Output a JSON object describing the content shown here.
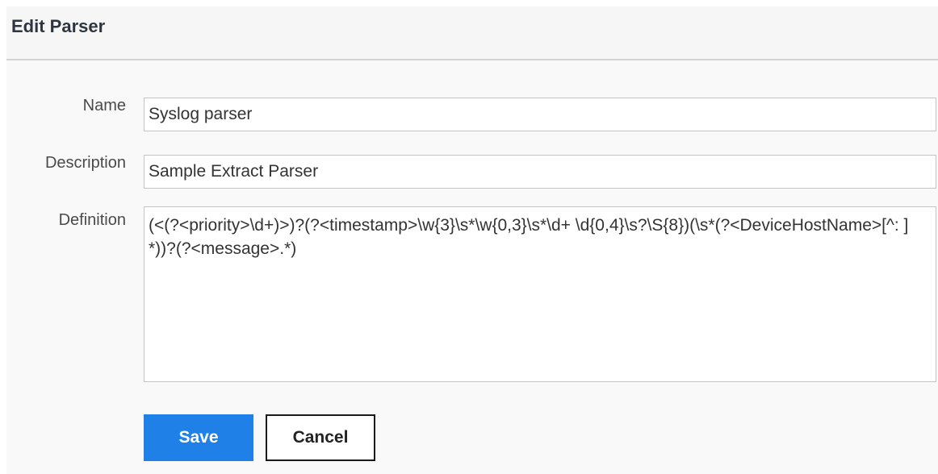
{
  "dialog": {
    "title": "Edit Parser"
  },
  "form": {
    "name": {
      "label": "Name",
      "value": "Syslog parser"
    },
    "description": {
      "label": "Description",
      "value": "Sample Extract Parser"
    },
    "definition": {
      "label": "Definition",
      "value": "(<(?<priority>\\d+)>)?(?<timestamp>\\w{3}\\s*\\w{0,3}\\s*\\d+ \\d{0,4}\\s?\\S{8})(\\s*(?<DeviceHostName>[^: ]*))?(?<message>.*)"
    }
  },
  "actions": {
    "save_label": "Save",
    "cancel_label": "Cancel"
  },
  "colors": {
    "primary_button": "#1f80e8",
    "header_bg": "#f6f6f6",
    "divider": "#d4d4d4"
  }
}
